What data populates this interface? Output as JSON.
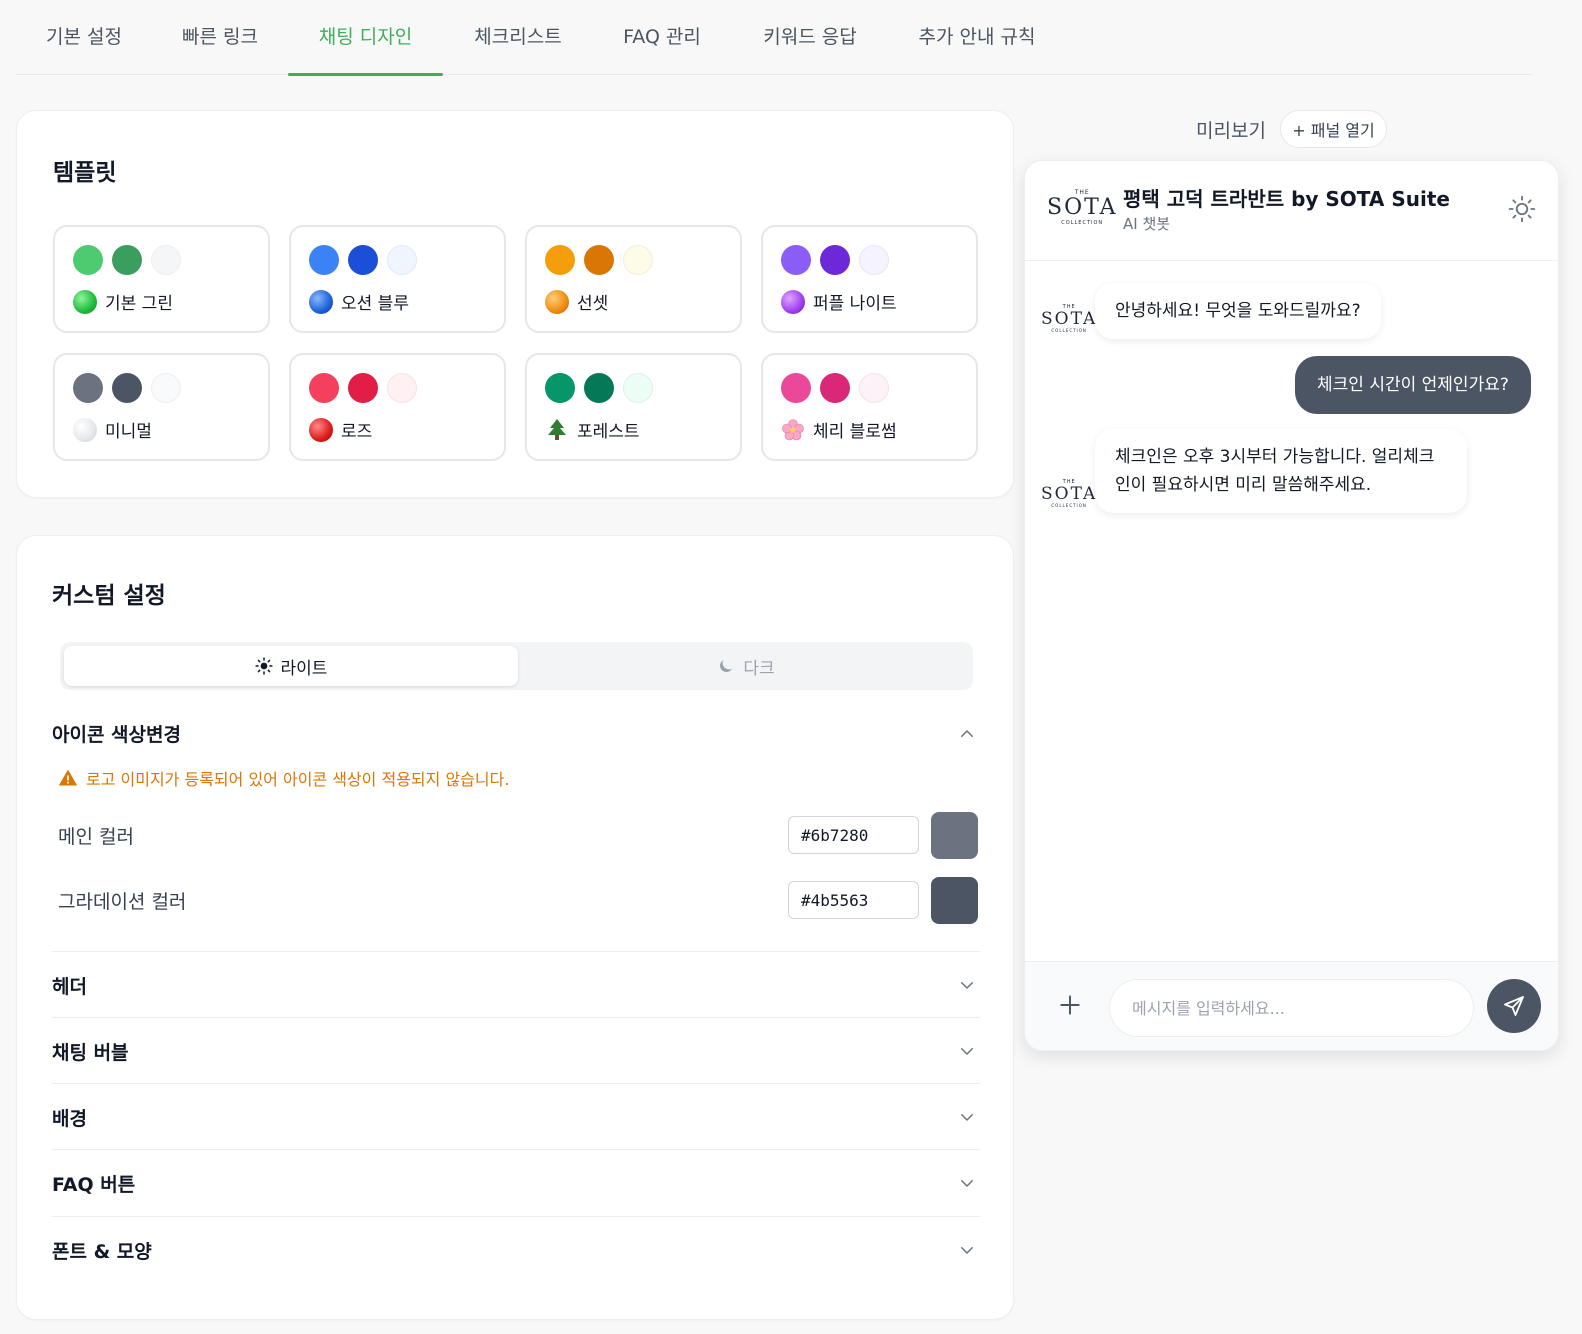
{
  "tabs": [
    {
      "label": "기본 설정",
      "active": false
    },
    {
      "label": "빠른 링크",
      "active": false
    },
    {
      "label": "채팅 디자인",
      "active": true
    },
    {
      "label": "체크리스트",
      "active": false
    },
    {
      "label": "FAQ 관리",
      "active": false
    },
    {
      "label": "키워드 응답",
      "active": false
    },
    {
      "label": "추가 안내 규칙",
      "active": false
    }
  ],
  "templates": {
    "title": "템플릿",
    "items": [
      {
        "name": "기본 그린",
        "colors": [
          "#4ecb71",
          "#3a9e5f",
          "#f5f6f7"
        ],
        "icon_color": "#1dbb3a"
      },
      {
        "name": "오션 블루",
        "colors": [
          "#3b82f6",
          "#1d4ed8",
          "#eff6ff"
        ],
        "icon_color": "#1d60d8"
      },
      {
        "name": "선셋",
        "colors": [
          "#f59e0b",
          "#d97706",
          "#fefce8"
        ],
        "icon_color": "#ef8a10"
      },
      {
        "name": "퍼플 나이트",
        "colors": [
          "#8b5cf6",
          "#6d28d9",
          "#f5f3ff"
        ],
        "icon_color": "#9d3ff0"
      },
      {
        "name": "미니멀",
        "colors": [
          "#6b7280",
          "#4b5563",
          "#f9fafb"
        ],
        "icon_color": "#e5e7eb"
      },
      {
        "name": "로즈",
        "colors": [
          "#f43f5e",
          "#e11d48",
          "#fff1f2"
        ],
        "icon_color": "#dc1a1a"
      },
      {
        "name": "포레스트",
        "colors": [
          "#059669",
          "#047857",
          "#ecfdf5"
        ],
        "icon": "tree-icon"
      },
      {
        "name": "체리 블로썸",
        "colors": [
          "#ec4899",
          "#db2777",
          "#fdf2f8"
        ],
        "icon": "blossom-icon"
      }
    ]
  },
  "custom": {
    "title": "커스텀 설정",
    "mode_light": "라이트",
    "mode_dark": "다크",
    "icon_section": "아이콘 색상변경",
    "warning": "로고 이미지가 등록되어 있어 아이콘 색상이 적용되지 않습니다.",
    "main_color_label": "메인 컬러",
    "main_color": "#6b7280",
    "gradient_color_label": "그라데이션 컬러",
    "gradient_color": "#4b5563",
    "sections": [
      "헤더",
      "채팅 버블",
      "배경",
      "FAQ 버튼",
      "폰트 & 모양"
    ]
  },
  "preview": {
    "label": "미리보기",
    "panel_button": "+ 패널 열기",
    "header_title": "평택 고덕 트라반트 by SOTA Suite",
    "header_subtitle": "AI 챗봇",
    "logo": {
      "the": "THE",
      "brand": "SOTA",
      "collection": "COLLECTION"
    },
    "messages": [
      {
        "from": "bot",
        "text": "안녕하세요! 무엇을 도와드릴까요?"
      },
      {
        "from": "user",
        "text": "체크인 시간이 언제인가요?"
      },
      {
        "from": "bot",
        "text": "체크인은 오후 3시부터 가능합니다. 얼리체크인이 필요하시면 미리 말씀해주세요."
      }
    ],
    "input_placeholder": "메시지를 입력하세요..."
  },
  "colors": {
    "accent": "#3fae5c",
    "warning": "#d97706",
    "user_bubble": "#4b5563"
  }
}
